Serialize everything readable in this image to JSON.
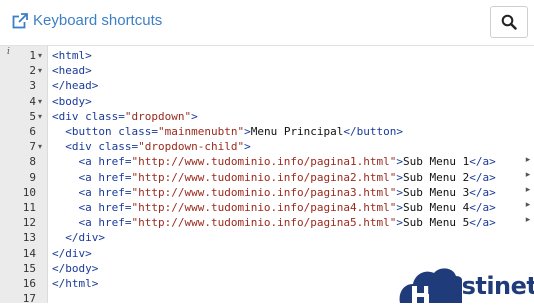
{
  "header": {
    "shortcuts_label": "Keyboard shortcuts"
  },
  "editor": {
    "lines": [
      {
        "num": "1",
        "fold": "▾",
        "segments": [
          {
            "c": "tag",
            "t": "<html>"
          }
        ]
      },
      {
        "num": "2",
        "fold": "▾",
        "segments": [
          {
            "c": "tag",
            "t": "<head>"
          }
        ]
      },
      {
        "num": "3",
        "fold": "",
        "segments": [
          {
            "c": "tag",
            "t": "</head>"
          }
        ]
      },
      {
        "num": "4",
        "fold": "▾",
        "segments": [
          {
            "c": "tag",
            "t": "<body>"
          }
        ]
      },
      {
        "num": "5",
        "fold": "▾",
        "segments": [
          {
            "c": "tag",
            "t": "<div "
          },
          {
            "c": "attr",
            "t": "class="
          },
          {
            "c": "str",
            "t": "\"dropdown\""
          },
          {
            "c": "tag",
            "t": ">"
          }
        ]
      },
      {
        "num": "6",
        "fold": "",
        "segments": [
          {
            "c": "tag",
            "t": "  <button "
          },
          {
            "c": "attr",
            "t": "class="
          },
          {
            "c": "str",
            "t": "\"mainmenubtn\""
          },
          {
            "c": "tag",
            "t": ">"
          },
          {
            "c": "txt",
            "t": "Menu Principal"
          },
          {
            "c": "tag",
            "t": "</button>"
          }
        ]
      },
      {
        "num": "7",
        "fold": "▾",
        "segments": [
          {
            "c": "tag",
            "t": "  <div "
          },
          {
            "c": "attr",
            "t": "class="
          },
          {
            "c": "str",
            "t": "\"dropdown-child\""
          },
          {
            "c": "tag",
            "t": ">"
          }
        ]
      },
      {
        "num": "8",
        "fold": "",
        "segments": [
          {
            "c": "tag",
            "t": "    <a "
          },
          {
            "c": "attr",
            "t": "href="
          },
          {
            "c": "str",
            "t": "\"http://www.tudominio.info/pagina1.html\""
          },
          {
            "c": "tag",
            "t": ">"
          },
          {
            "c": "txt",
            "t": "Sub Menu 1"
          },
          {
            "c": "tag",
            "t": "</a>"
          }
        ]
      },
      {
        "num": "9",
        "fold": "",
        "segments": [
          {
            "c": "tag",
            "t": "    <a "
          },
          {
            "c": "attr",
            "t": "href="
          },
          {
            "c": "str",
            "t": "\"http://www.tudominio.info/pagina2.html\""
          },
          {
            "c": "tag",
            "t": ">"
          },
          {
            "c": "txt",
            "t": "Sub Menu 2"
          },
          {
            "c": "tag",
            "t": "</a>"
          }
        ]
      },
      {
        "num": "10",
        "fold": "",
        "segments": [
          {
            "c": "tag",
            "t": "    <a "
          },
          {
            "c": "attr",
            "t": "href="
          },
          {
            "c": "str",
            "t": "\"http://www.tudominio.info/pagina3.html\""
          },
          {
            "c": "tag",
            "t": ">"
          },
          {
            "c": "txt",
            "t": "Sub Menu 3"
          },
          {
            "c": "tag",
            "t": "</a>"
          }
        ]
      },
      {
        "num": "11",
        "fold": "",
        "segments": [
          {
            "c": "tag",
            "t": "    <a "
          },
          {
            "c": "attr",
            "t": "href="
          },
          {
            "c": "str",
            "t": "\"http://www.tudominio.info/pagina4.html\""
          },
          {
            "c": "tag",
            "t": ">"
          },
          {
            "c": "txt",
            "t": "Sub Menu 4"
          },
          {
            "c": "tag",
            "t": "</a>"
          }
        ]
      },
      {
        "num": "12",
        "fold": "",
        "segments": [
          {
            "c": "tag",
            "t": "    <a "
          },
          {
            "c": "attr",
            "t": "href="
          },
          {
            "c": "str",
            "t": "\"http://www.tudominio.info/pagina5.html\""
          },
          {
            "c": "tag",
            "t": ">"
          },
          {
            "c": "txt",
            "t": "Sub Menu 5"
          },
          {
            "c": "tag",
            "t": "</a>"
          }
        ]
      },
      {
        "num": "13",
        "fold": "",
        "segments": [
          {
            "c": "tag",
            "t": "  </div>"
          }
        ]
      },
      {
        "num": "14",
        "fold": "",
        "segments": [
          {
            "c": "tag",
            "t": "</div>"
          }
        ]
      },
      {
        "num": "15",
        "fold": "",
        "segments": [
          {
            "c": "tag",
            "t": "</body>"
          }
        ]
      },
      {
        "num": "16",
        "fold": "",
        "segments": [
          {
            "c": "tag",
            "t": "</html>"
          }
        ]
      },
      {
        "num": "17",
        "fold": "",
        "segments": []
      }
    ]
  },
  "watermark": {
    "text": "Hostinet"
  },
  "colors": {
    "link": "#3d7fc5",
    "tag": "#1a3b9a",
    "string": "#9b2a1e",
    "gutter": "#ebebeb",
    "logo": "#1f3b79"
  }
}
